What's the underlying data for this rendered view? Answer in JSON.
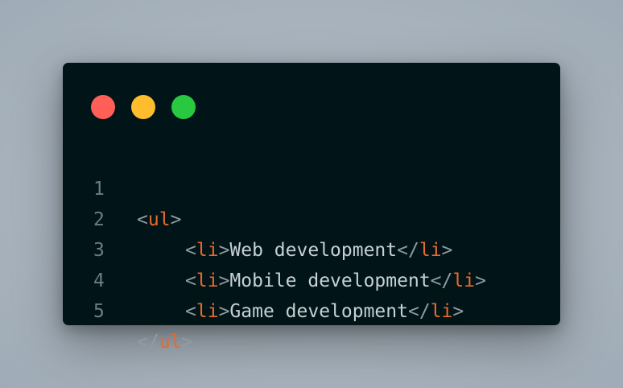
{
  "window": {
    "controls": [
      {
        "name": "close",
        "color": "#ff5f57"
      },
      {
        "name": "minimize",
        "color": "#ffbd2e"
      },
      {
        "name": "maximize",
        "color": "#28c840"
      }
    ]
  },
  "code": {
    "lines": [
      {
        "number": "1",
        "open_lt": "<",
        "open_tag": "ul",
        "open_gt": ">",
        "text": "",
        "close_lt": "",
        "close_tag": "",
        "close_gt": ""
      },
      {
        "number": "2",
        "open_lt": "<",
        "open_tag": "li",
        "open_gt": ">",
        "text": "Web development",
        "close_lt": "</",
        "close_tag": "li",
        "close_gt": ">"
      },
      {
        "number": "3",
        "open_lt": "<",
        "open_tag": "li",
        "open_gt": ">",
        "text": "Mobile development",
        "close_lt": "</",
        "close_tag": "li",
        "close_gt": ">"
      },
      {
        "number": "4",
        "open_lt": "<",
        "open_tag": "li",
        "open_gt": ">",
        "text": "Game development",
        "close_lt": "</",
        "close_tag": "li",
        "close_gt": ">"
      },
      {
        "number": "5",
        "open_lt": "</",
        "open_tag": "ul",
        "open_gt": ">",
        "text": "",
        "close_lt": "",
        "close_tag": "",
        "close_gt": ""
      }
    ]
  },
  "colors": {
    "background": "#011519",
    "tag": "#e66a2d",
    "text": "#c6d0d5",
    "punctuation": "#8f9ca2",
    "line_number": "#6d7c82"
  }
}
